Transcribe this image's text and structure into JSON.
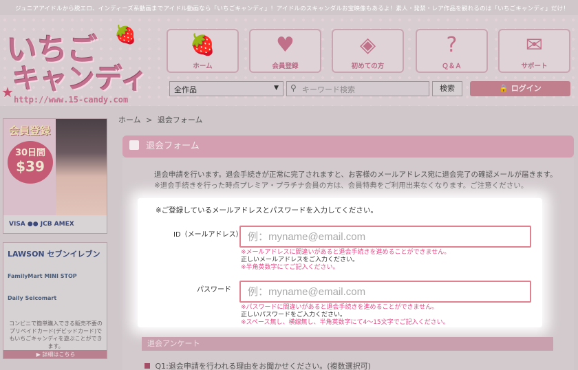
{
  "tagline": "ジュニアアイドルから脱エロ、インディーズ系動画までアイドル動画なら「いちごキャンディ」！アイドルのスキャンダルお宝映像もあるよ！素人・発禁・レア作品を観れるのは「いちごキャンディ」だけ！",
  "logo": {
    "line1": "いちご",
    "line2": "キャンディ",
    "url": "http://www.15-candy.com"
  },
  "nav": [
    {
      "label": "ホーム",
      "icon": "strawberry-icon"
    },
    {
      "label": "会員登録",
      "icon": "heart-plus-icon"
    },
    {
      "label": "初めての方",
      "icon": "beginner-mark-icon"
    },
    {
      "label": "Ｑ＆Ａ",
      "icon": "question-bubble-icon"
    },
    {
      "label": "サポート",
      "icon": "mail-icon"
    }
  ],
  "search": {
    "category": "全作品",
    "placeholder": "キーワード検索",
    "button": "検索"
  },
  "login_label": "ログイン",
  "sidebar": {
    "banner1": {
      "title": "会員登録",
      "days": "30日間",
      "price": "$39",
      "cards": "VISA ●● JCB AMEX"
    },
    "banner2": {
      "title": "LAWSON セブンイレブン",
      "row1": "FamilyMart  MINI STOP",
      "row2": "Daily  Seicomart",
      "desc": "コンビニで簡単購入できる販売不要のプリペイドカード(デビッドカード)でもいちごキャンディを遊ぶことができます。",
      "footer": "▶ 詳細はこちら"
    }
  },
  "breadcrumb": {
    "home": "ホーム",
    "sep": ">",
    "current": "退会フォーム"
  },
  "section_title": "退会フォーム",
  "intro": {
    "line1": "退会申請を行います。退会手続きが正常に完了されますと、お客様のメールアドレス宛に退会完了の確認メールが届きます。",
    "line2": "※退会手続きを行った時点プレミア・プラチナ会員の方は、会員特典をご利用出来なくなります。ご注意ください。"
  },
  "form": {
    "note": "※ご登録しているメールアドレスとパスワードを入力してください。",
    "id_label": "ID（メールアドレス）",
    "id_placeholder": "例：myname@email.com",
    "id_help1": "※メールアドレスに間違いがあると退会手続きを進めることができません。",
    "id_help2": "正しいメールアドレスをご入力ください。",
    "id_help3": "※半角英数字にてご記入ください。",
    "pw_label": "パスワード",
    "pw_placeholder": "例：myname@email.com",
    "pw_help1": "※パスワードに間違いがあると退会手続きを進めることができません。",
    "pw_help2": "正しいパスワードをご入力ください。",
    "pw_help3": "※スペース無し、横線無し、半角英数字にて4〜15文字でご記入ください。"
  },
  "survey": {
    "title": "退会アンケート",
    "q1": "Q1:退会申請を行われる理由をお聞かせください。(複数選択可)"
  }
}
